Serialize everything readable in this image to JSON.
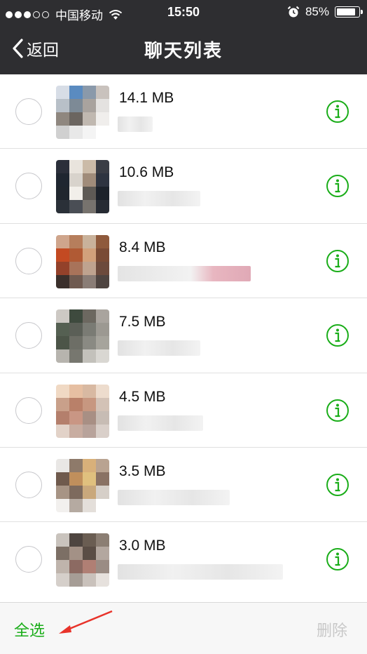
{
  "status_bar": {
    "carrier": "中国移动",
    "time": "15:50",
    "battery": "85%",
    "battery_level": 0.85,
    "signal_full_dots": 3,
    "signal_empty_dots": 2
  },
  "nav": {
    "back_label": "返回",
    "title": "聊天列表"
  },
  "chats": [
    {
      "size": "14.1 MB"
    },
    {
      "size": "10.6 MB"
    },
    {
      "size": "8.4 MB"
    },
    {
      "size": "7.5 MB"
    },
    {
      "size": "4.5 MB"
    },
    {
      "size": "3.5 MB"
    },
    {
      "size": "3.0 MB"
    }
  ],
  "toolbar": {
    "select_all_label": "全选",
    "delete_label": "删除"
  },
  "colors": {
    "nav_background": "#2e2e31",
    "accent_green": "#1aad19",
    "arrow_red": "#e8332a",
    "disabled_gray": "#c8c8c8"
  },
  "icons": {
    "back": "chevron-left-icon",
    "info": "info-circle-icon",
    "wifi": "wifi-icon",
    "alarm": "alarm-clock-icon",
    "battery": "battery-icon"
  }
}
